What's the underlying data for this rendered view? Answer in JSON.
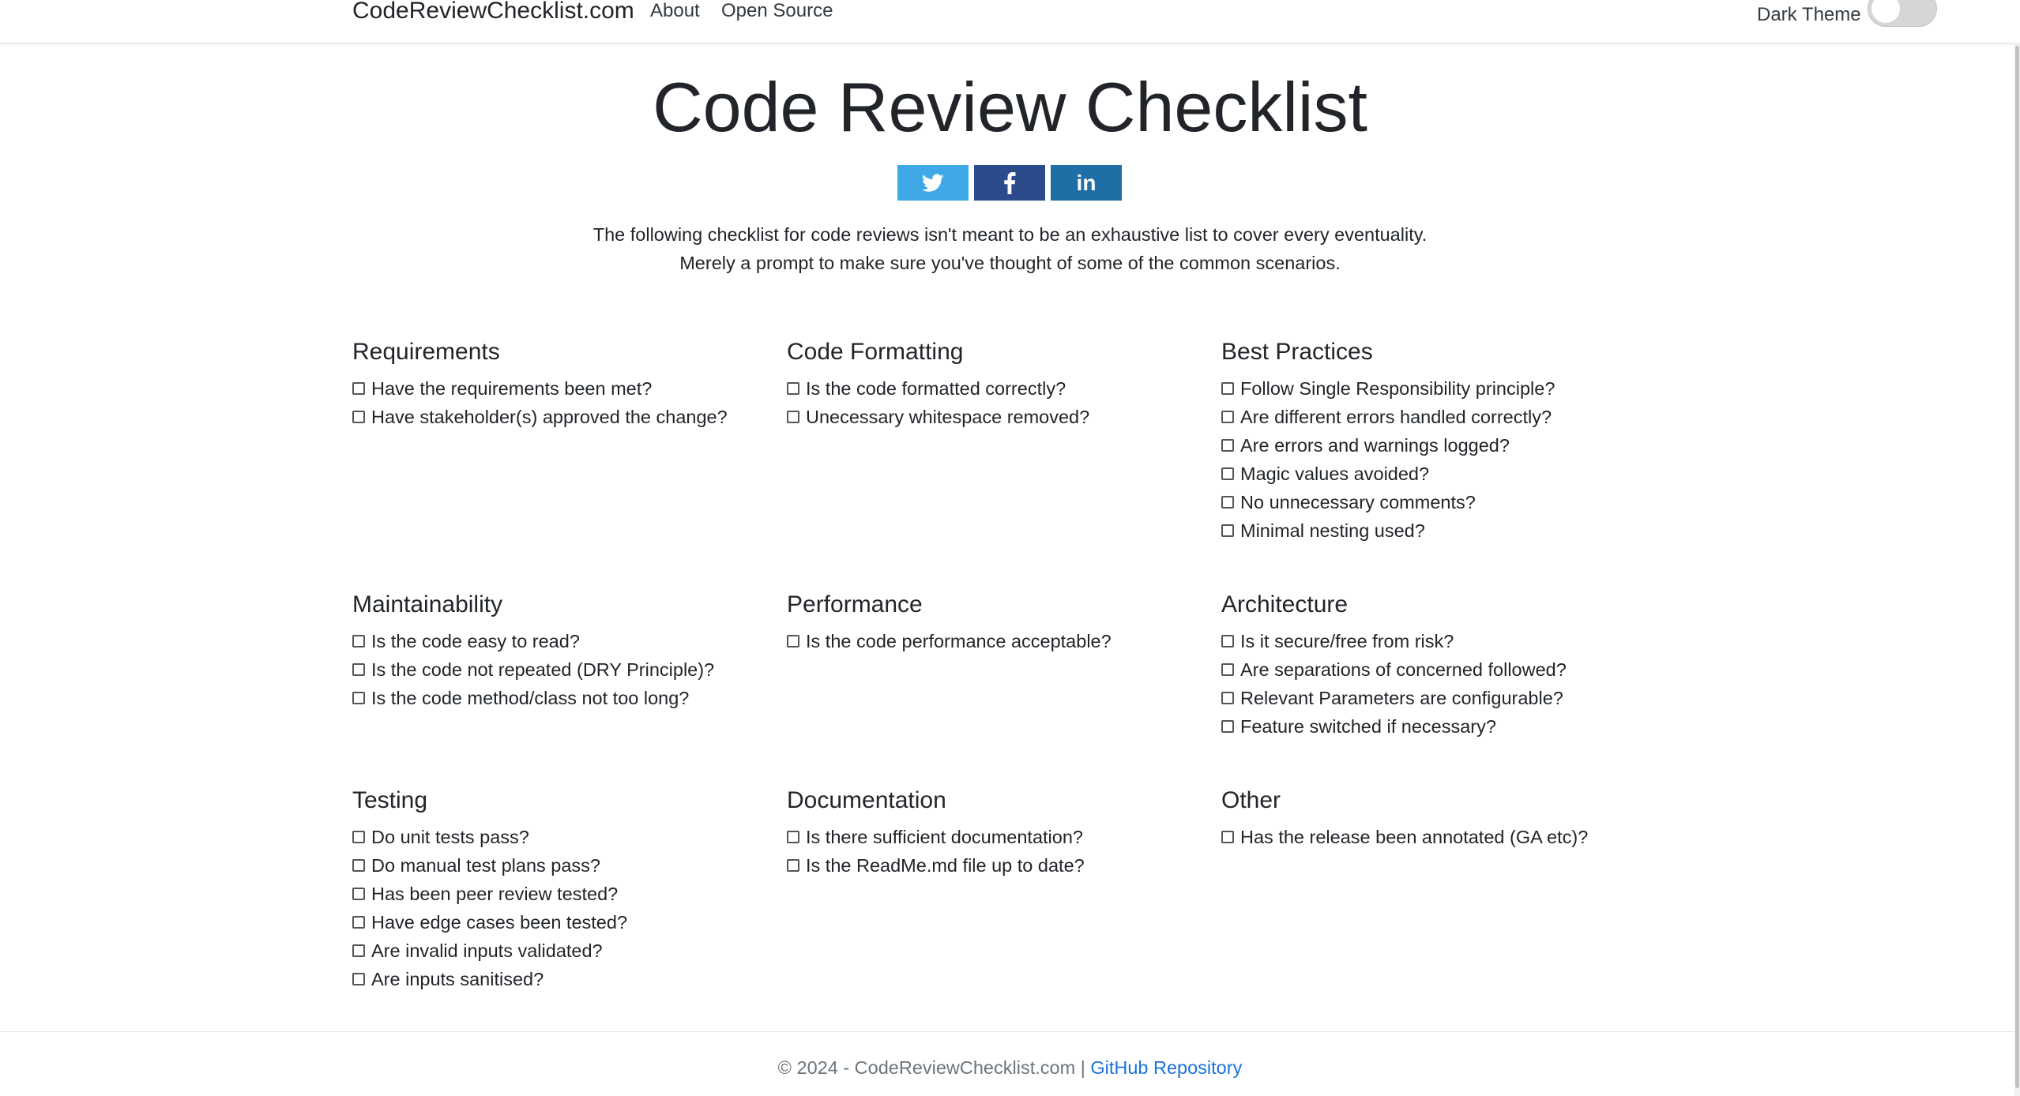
{
  "navbar": {
    "brand": "CodeReviewChecklist.com",
    "links": [
      "About",
      "Open Source"
    ],
    "theme_label": "Dark Theme"
  },
  "title": "Code Review Checklist",
  "share": {
    "icons": [
      "twitter-icon",
      "facebook-icon",
      "linkedin-icon"
    ],
    "linkedin_text": "in",
    "colors": {
      "twitter": "#3ea9e6",
      "facebook": "#2b4b8d",
      "linkedin": "#1f6fa6"
    }
  },
  "intro": {
    "line1": "The following checklist for code reviews isn't meant to be an exhaustive list to cover every eventuality.",
    "line2": "Merely a prompt to make sure you've thought of some of the common scenarios."
  },
  "sections": [
    {
      "title": "Requirements",
      "items": [
        "Have the requirements been met?",
        "Have stakeholder(s) approved the change?"
      ]
    },
    {
      "title": "Code Formatting",
      "items": [
        "Is the code formatted correctly?",
        "Unecessary whitespace removed?"
      ]
    },
    {
      "title": "Best Practices",
      "items": [
        "Follow Single Responsibility principle?",
        "Are different errors handled correctly?",
        "Are errors and warnings logged?",
        "Magic values avoided?",
        "No unnecessary comments?",
        "Minimal nesting used?"
      ]
    },
    {
      "title": "Maintainability",
      "items": [
        "Is the code easy to read?",
        "Is the code not repeated (DRY Principle)?",
        "Is the code method/class not too long?"
      ]
    },
    {
      "title": "Performance",
      "items": [
        "Is the code performance acceptable?"
      ]
    },
    {
      "title": "Architecture",
      "items": [
        "Is it secure/free from risk?",
        "Are separations of concerned followed?",
        "Relevant Parameters are configurable?",
        "Feature switched if necessary?"
      ]
    },
    {
      "title": "Testing",
      "items": [
        "Do unit tests pass?",
        "Do manual test plans pass?",
        "Has been peer review tested?",
        "Have edge cases been tested?",
        "Are invalid inputs validated?",
        "Are inputs sanitised?"
      ]
    },
    {
      "title": "Documentation",
      "items": [
        "Is there sufficient documentation?",
        "Is the ReadMe.md file up to date?"
      ]
    },
    {
      "title": "Other",
      "items": [
        "Has the release been annotated (GA etc)?"
      ]
    }
  ],
  "footer": {
    "copyright": "© 2024 - CodeReviewChecklist.com",
    "separator": "|",
    "link": "GitHub Repository",
    "link_color": "#1a73d9"
  }
}
